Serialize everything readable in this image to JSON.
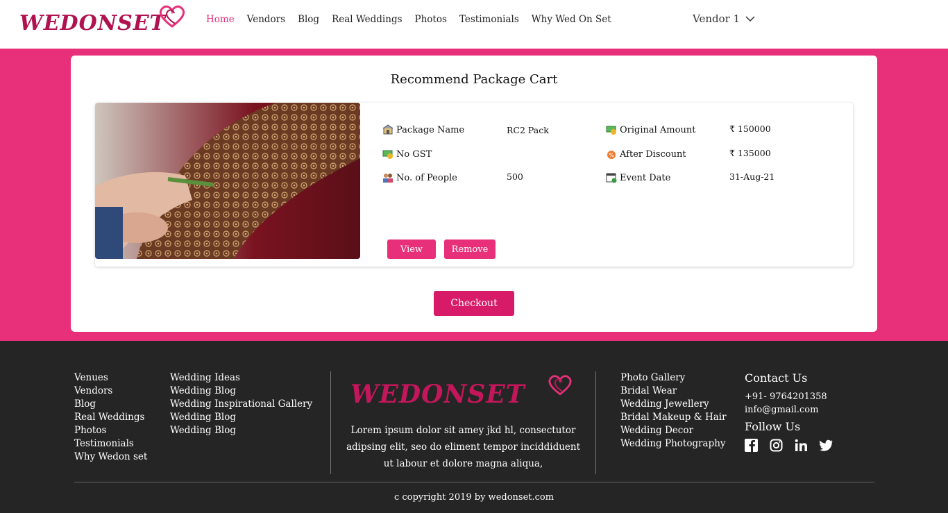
{
  "brand": {
    "name": "WEDONSET",
    "color": "#b0124f"
  },
  "nav": {
    "items": [
      {
        "label": "Home",
        "active": true
      },
      {
        "label": "Vendors"
      },
      {
        "label": "Blog"
      },
      {
        "label": "Real Weddings"
      },
      {
        "label": "Photos"
      },
      {
        "label": "Testimonials"
      },
      {
        "label": "Why Wed On Set"
      }
    ],
    "user": "Vendor 1"
  },
  "cart": {
    "title": "Recommend Package Cart",
    "package": {
      "labels": {
        "name": "Package Name",
        "gst": "No GST",
        "people": "No. of People",
        "original": "Original Amount",
        "discount": "After Discount",
        "event": "Event Date"
      },
      "values": {
        "name": "RC2 Pack",
        "people": "500",
        "original": "₹  150000",
        "discount": "₹  135000",
        "event": "31-Aug-21"
      },
      "view_label": "View",
      "remove_label": "Remove"
    },
    "checkout_label": "Checkout"
  },
  "footer": {
    "col1": [
      "Venues",
      "Vendors",
      "Blog",
      "Real Weddings",
      "Photos",
      "Testimonials",
      "Why Wedon set"
    ],
    "col2": [
      "Wedding Ideas",
      "Wedding Blog",
      "Wedding Inspirational Gallery",
      "Wedding Blog",
      "Wedding Blog"
    ],
    "description": "Lorem ipsum dolor sit amey jkd hl, consectutor adipsing elit, seo do eliment tempor inciddiduent ut labour et dolore magna aliqua,",
    "col3": [
      "Photo Gallery",
      "Bridal Wear",
      "Wedding Jewellery",
      "Bridal Makeup & Hair",
      "Wedding Decor",
      "Wedding Photography"
    ],
    "contact_title": "Contact Us",
    "phone": "+91- 9764201358",
    "email": "info@gmail.com",
    "follow_title": "Follow Us",
    "social": [
      "facebook-icon",
      "instagram-icon",
      "linkedin-icon",
      "twitter-icon"
    ],
    "copyright": "c copyright 2019 by wedonset.com"
  },
  "colors": {
    "accent": "#e8307a",
    "footer_bg": "#252525",
    "checkout": "#d81b68"
  }
}
